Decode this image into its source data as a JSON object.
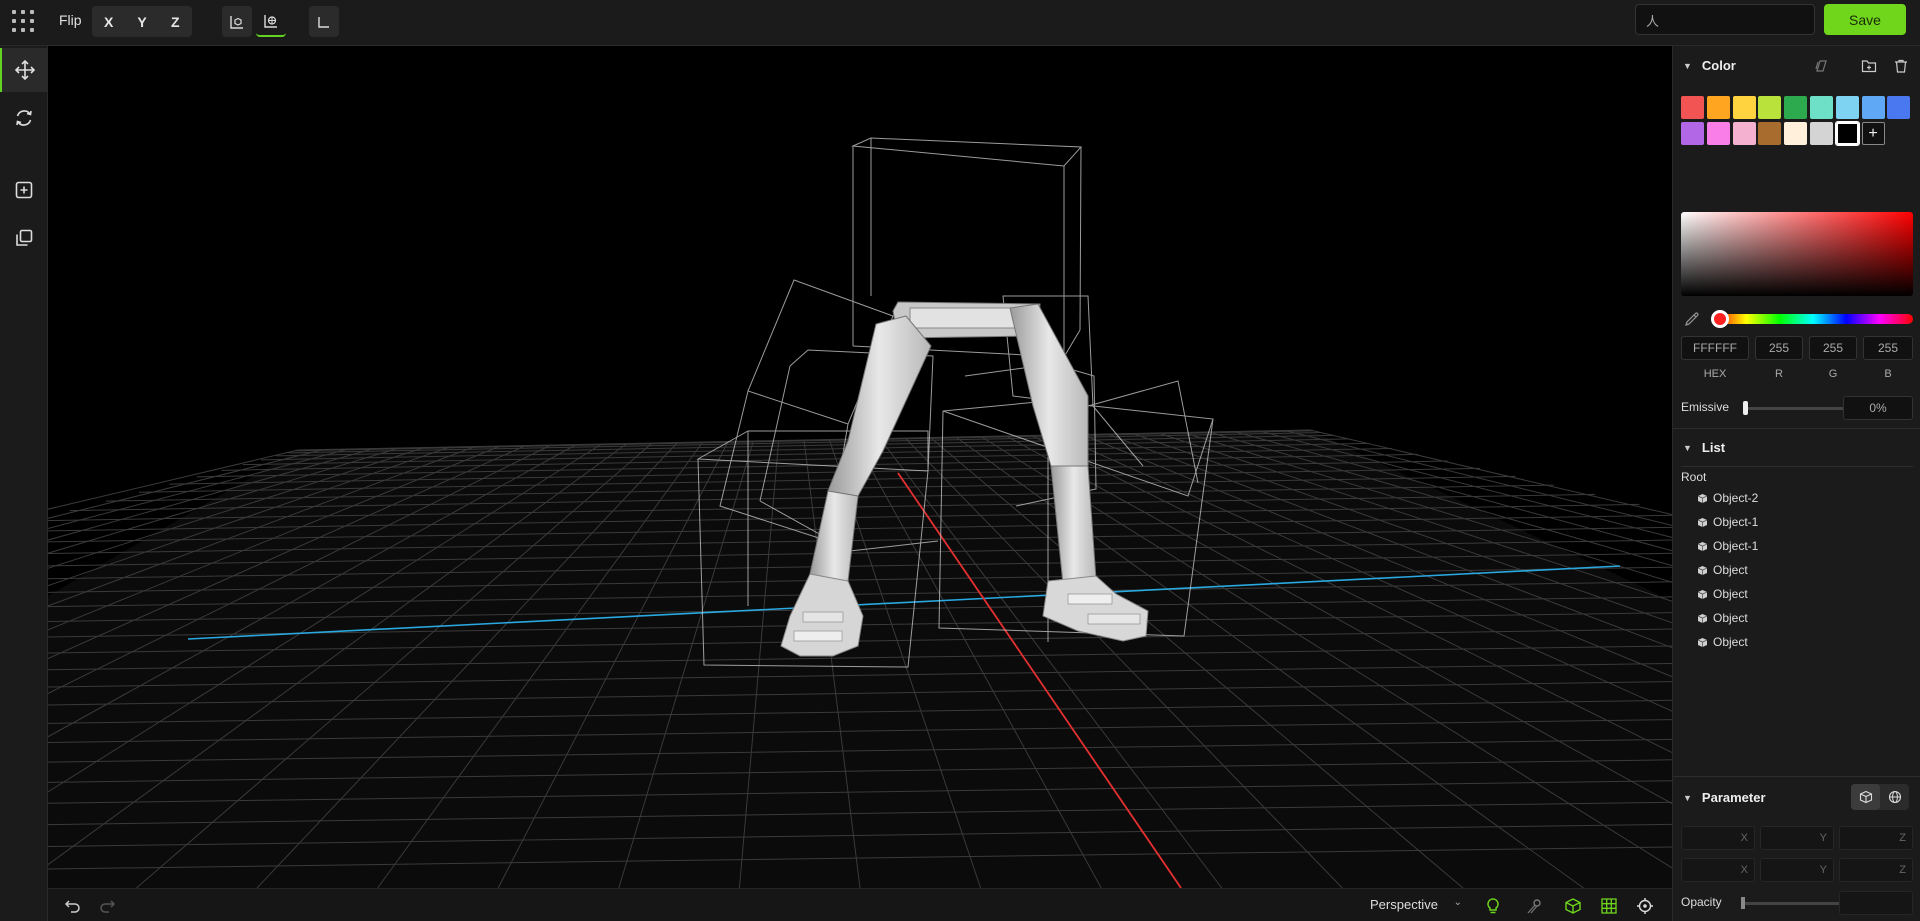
{
  "toolbar": {
    "flip_label": "Flip",
    "axes": [
      "X",
      "Y",
      "Z"
    ],
    "search_value": "人",
    "save_label": "Save"
  },
  "colors": {
    "accent": "#6fd61c",
    "x_axis": "#e53030",
    "z_axis": "#2aa8e0"
  },
  "color_panel": {
    "title": "Color",
    "swatches": [
      "#f25353",
      "#ffa51f",
      "#ffd23f",
      "#b9e23a",
      "#2eaa4e",
      "#6fe0c8",
      "#7fd3f2",
      "#5ea8f5",
      "#4a78f0",
      "#b267e6",
      "#f97ee8",
      "#f5b2d0",
      "#a86c2f",
      "#fff0dc",
      "#d4d4d4",
      "#ffffff"
    ],
    "add_label": "+",
    "hex": "FFFFFF",
    "r": "255",
    "g": "255",
    "b": "255",
    "labels": {
      "hex": "HEX",
      "r": "R",
      "g": "G",
      "b": "B"
    },
    "emissive_label": "Emissive",
    "emissive_value": "0%",
    "emissive_level": 0
  },
  "list_panel": {
    "title": "List",
    "root_label": "Root",
    "items": [
      "Object-2",
      "Object-1",
      "Object-1",
      "Object",
      "Object",
      "Object",
      "Object"
    ]
  },
  "parameter_panel": {
    "title": "Parameter",
    "row1": [
      "X",
      "Y",
      "Z"
    ],
    "row2": [
      "X",
      "Y",
      "Z"
    ],
    "opacity_label": "Opacity"
  },
  "bottombar": {
    "camera_mode": "Perspective"
  }
}
